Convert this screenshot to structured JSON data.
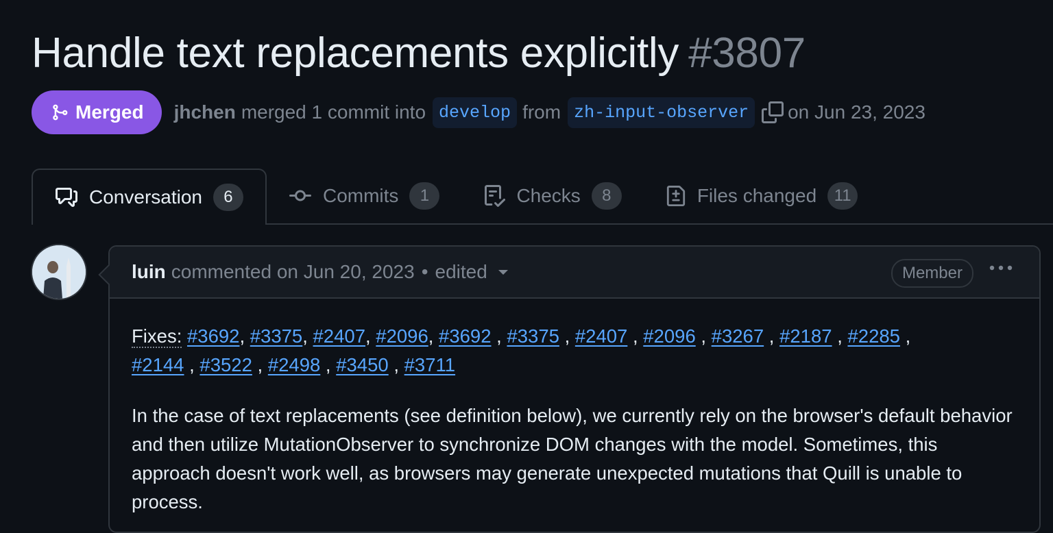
{
  "pr": {
    "title": "Handle text replacements explicitly",
    "number": "#3807",
    "status": "Merged",
    "author": "jhchen",
    "merged_text": "merged 1 commit into",
    "base_branch": "develop",
    "from_text": "from",
    "head_branch": "zh-input-observer",
    "date_text": "on Jun 23, 2023"
  },
  "tabs": [
    {
      "label": "Conversation",
      "count": "6",
      "icon": "comment-discussion-icon"
    },
    {
      "label": "Commits",
      "count": "1",
      "icon": "git-commit-icon"
    },
    {
      "label": "Checks",
      "count": "8",
      "icon": "checklist-icon"
    },
    {
      "label": "Files changed",
      "count": "11",
      "icon": "file-diff-icon"
    }
  ],
  "comment": {
    "author": "luin",
    "action": "commented on Jun 20, 2023",
    "separator": "•",
    "edited": "edited",
    "badge": "Member",
    "fixes_label": "Fixes:",
    "issues": [
      "#3692",
      "#3375",
      "#2407",
      "#2096",
      "#3692",
      "#3375",
      "#2407",
      "#2096",
      "#3267",
      "#2187",
      "#2285",
      "#2144",
      "#3522",
      "#2498",
      "#3450",
      "#3711"
    ],
    "paragraph": "In the case of text replacements (see definition below), we currently rely on the browser's default behavior and then utilize MutationObserver to synchronize DOM changes with the model. Sometimes, this approach doesn't work well, as browsers may generate unexpected mutations that Quill is unable to process."
  },
  "colors": {
    "background": "#0d1117",
    "merged": "#8957e5",
    "link": "#58a6ff",
    "muted": "#7d8590",
    "border": "#30363d"
  }
}
